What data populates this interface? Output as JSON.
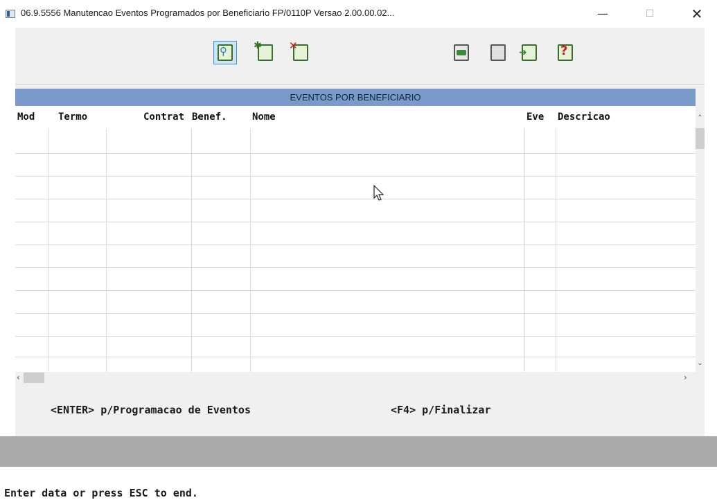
{
  "window": {
    "title": "06.9.5556 Manutencao Eventos Programados por Beneficiario FP/0110P Versao 2.00.00.02...",
    "minimize": "—",
    "maximize": "☐",
    "close": "✕"
  },
  "toolbar": {
    "left_buttons": [
      {
        "icon": "search-icon",
        "mark": "🔍",
        "active": true
      },
      {
        "icon": "add-record-icon",
        "mark": "*"
      },
      {
        "icon": "delete-record-icon",
        "mark": "✕"
      }
    ],
    "right_buttons": [
      {
        "icon": "print-icon",
        "mark": "🖶"
      },
      {
        "icon": "copy-icon",
        "mark": "❐"
      },
      {
        "icon": "exit-icon",
        "mark": "➜"
      },
      {
        "icon": "help-icon",
        "mark": "?"
      }
    ]
  },
  "grid": {
    "title": "EVENTOS POR BENEFICIARIO",
    "columns": [
      "Mod",
      "Termo",
      "Contrat",
      "Benef.",
      "Nome",
      "Eve",
      "Descricao"
    ],
    "row_count": 11
  },
  "hints": {
    "enter": "<ENTER> p/Programacao de Eventos",
    "f4": "<F4> p/Finalizar"
  },
  "status": "Enter data or press ESC to end."
}
